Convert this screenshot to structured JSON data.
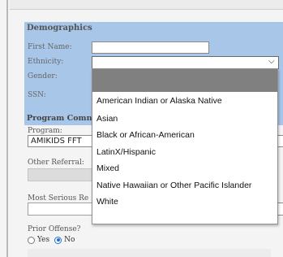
{
  "demographics": {
    "title": "Demographics",
    "first_name_label": "First Name:",
    "first_name_value": "",
    "ethnicity_label": "Ethnicity:",
    "ethnicity_selected": "",
    "gender_label": "Gender:",
    "ssn_label": "SSN:"
  },
  "ethnicity_dropdown": {
    "options": [
      "",
      "American Indian or Alaska Native",
      "Asian",
      "Black or African-American",
      "LatinX/Hispanic",
      "Mixed",
      "Native Hawaiian or Other Pacific Islander",
      "White"
    ]
  },
  "program_section": {
    "title": "Program Comn",
    "program_label": "Program:",
    "program_value": "AMIKIDS FFT",
    "other_referral_label": "Other Referral:",
    "most_serious_label": "Most Serious Re",
    "prior_offense_label": "Prior Offense?",
    "prior_offense_options": [
      "Yes",
      "No"
    ],
    "prior_offense_selected": "No"
  },
  "colors": {
    "demographics_panel": "#a8c6e8",
    "highlight": "#808080",
    "radio_accent": "#1a6fd0"
  }
}
